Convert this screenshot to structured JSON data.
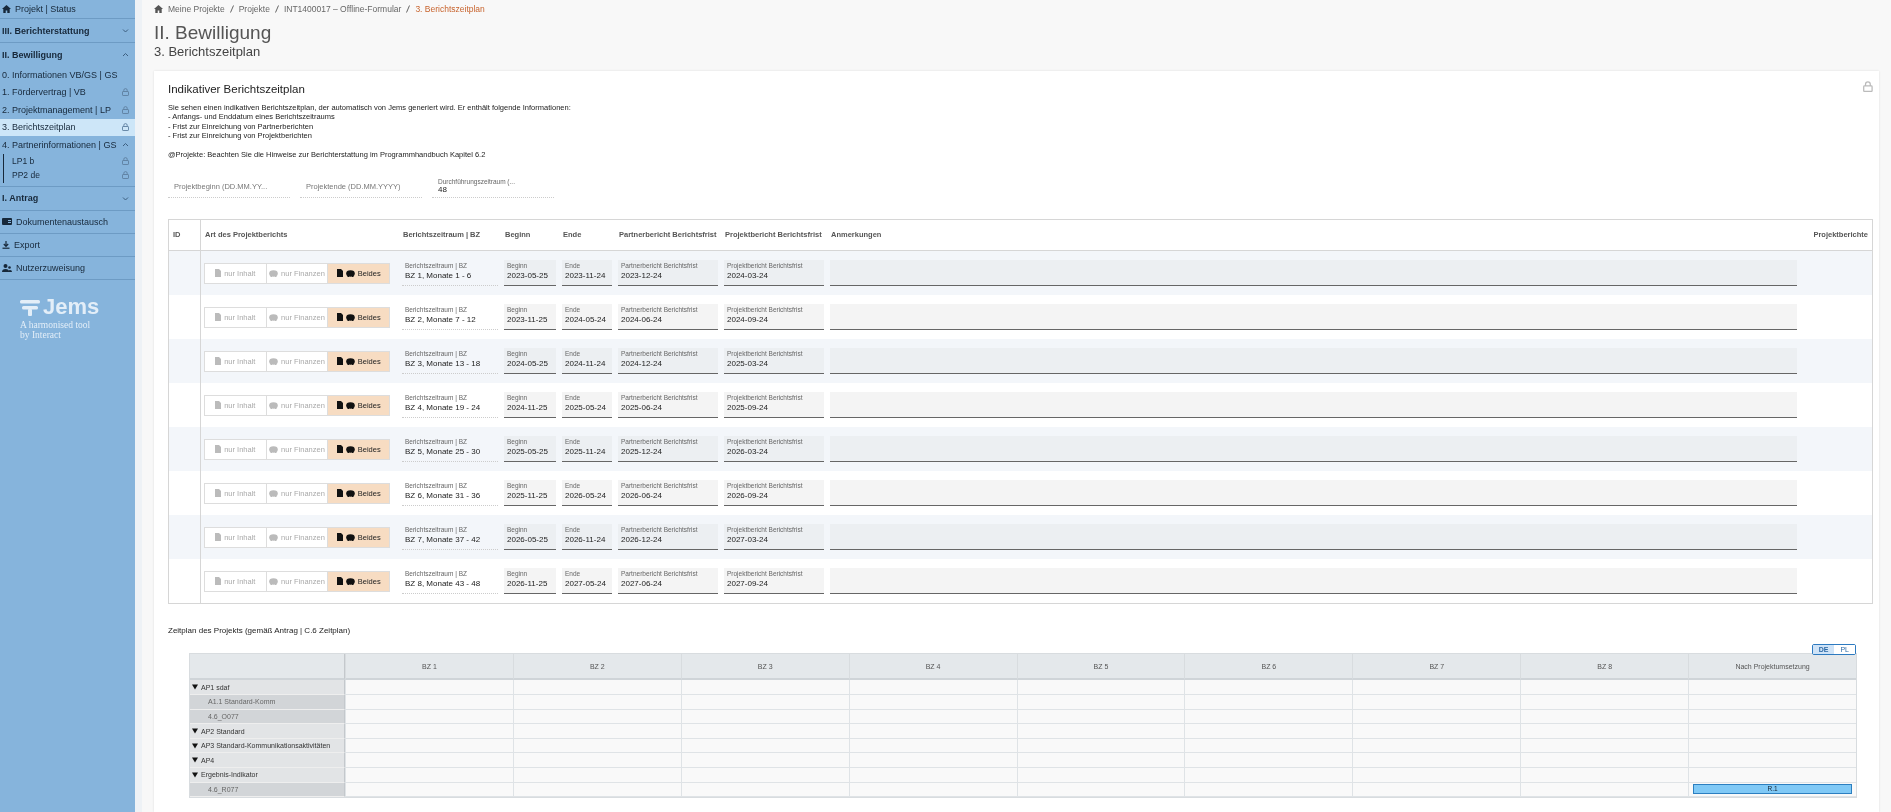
{
  "sidebar": {
    "items": [
      {
        "kind": "link",
        "label": "Projekt | Status",
        "selected": false
      },
      {
        "kind": "section",
        "label": "III. Berichterstattung",
        "expanded": false,
        "selected": false
      },
      {
        "kind": "section",
        "label": "II. Bewilligung",
        "expanded": true,
        "selected": false,
        "children": [
          {
            "label": "0. Informationen VB/GS | GS",
            "locked": false,
            "selected": false
          },
          {
            "label": "1. Fördervertrag | VB",
            "locked": true,
            "selected": false
          },
          {
            "label": "2. Projektmanagement | LP",
            "locked": true,
            "selected": false
          },
          {
            "label": "3. Berichtszeitplan",
            "locked": true,
            "selected": true
          },
          {
            "label": "4. Partnerinformationen | GS",
            "locked": false,
            "selected": false,
            "expanded": true,
            "children": [
              {
                "label": "LP1 b",
                "locked": true,
                "selected": false
              },
              {
                "label": "PP2 de",
                "locked": true,
                "selected": false
              }
            ]
          }
        ]
      },
      {
        "kind": "section",
        "label": "I. Antrag",
        "expanded": false,
        "selected": false
      },
      {
        "kind": "link",
        "label": "Dokumentenaustausch",
        "selected": false
      },
      {
        "kind": "link",
        "label": "Export",
        "selected": false
      },
      {
        "kind": "link",
        "label": "Nutzerzuweisung",
        "selected": false
      }
    ],
    "logo": {
      "name": "Jems",
      "tagline": "A harmonised tool",
      "by": "by Interact"
    }
  },
  "breadcrumb": [
    {
      "label": "Meine Projekte",
      "selected": false
    },
    {
      "label": "Projekte",
      "selected": false
    },
    {
      "label": "INT1400017 – Offline-Formular",
      "selected": false
    },
    {
      "label": "3. Berichtszeitplan",
      "selected": true
    }
  ],
  "page": {
    "title": "II. Bewilligung",
    "subtitle": "3. Berichtszeitplan"
  },
  "card": {
    "title": "Indikativer Berichtszeitplan",
    "locked": true,
    "intro": "Sie sehen einen indikativen Berichtszeitplan, der automatisch von Jems generiert wird. Er enthält folgende Informationen:",
    "bullets": [
      "- Anfangs- und Enddatum eines Berichtszeitraums",
      "- Frist zur Einreichung von Partnerberichten",
      "- Frist zur Einreichung von Projektberichten"
    ],
    "note": "@Projekte: Beachten Sie die Hinweise zur Berichterstattung im Programmhandbuch Kapitel 6.2",
    "fields": [
      {
        "placeholder": "Projektbeginn (DD.MM.YY..."
      },
      {
        "placeholder": "Projektende (DD.MM.YYYY)"
      },
      {
        "label": "Durchführungszeitraum (...",
        "value": "48"
      }
    ],
    "table": {
      "columns": [
        "ID",
        "Art des Projektberichts",
        "Berichtszeitraum | BZ",
        "Beginn",
        "Ende",
        "Partnerbericht Berichtsfrist",
        "Projektbericht Berichtsfrist",
        "Anmerkungen",
        "Projektberichte"
      ],
      "rows": [
        {
          "type_options": [
            {
              "label": "nur Inhalt",
              "selected": false
            },
            {
              "label": "nur Finanzen",
              "selected": false
            },
            {
              "label": "Beides",
              "selected": true
            }
          ],
          "fields": [
            {
              "label": "Berichtszeitraum | BZ",
              "value": "BZ 1, Monate 1 - 6"
            },
            {
              "label": "Beginn",
              "value": "2023-05-25"
            },
            {
              "label": "Ende",
              "value": "2023-11-24"
            },
            {
              "label": "Partnerbericht Berichtsfrist",
              "value": "2023-12-24"
            },
            {
              "label": "Projektbericht Berichtsfrist",
              "value": "2024-03-24"
            }
          ]
        },
        {
          "type_options": [
            {
              "label": "nur Inhalt",
              "selected": false
            },
            {
              "label": "nur Finanzen",
              "selected": false
            },
            {
              "label": "Beides",
              "selected": true
            }
          ],
          "fields": [
            {
              "label": "Berichtszeitraum | BZ",
              "value": "BZ 2, Monate 7 - 12"
            },
            {
              "label": "Beginn",
              "value": "2023-11-25"
            },
            {
              "label": "Ende",
              "value": "2024-05-24"
            },
            {
              "label": "Partnerbericht Berichtsfrist",
              "value": "2024-06-24"
            },
            {
              "label": "Projektbericht Berichtsfrist",
              "value": "2024-09-24"
            }
          ]
        },
        {
          "type_options": [
            {
              "label": "nur Inhalt",
              "selected": false
            },
            {
              "label": "nur Finanzen",
              "selected": false
            },
            {
              "label": "Beides",
              "selected": true
            }
          ],
          "fields": [
            {
              "label": "Berichtszeitraum | BZ",
              "value": "BZ 3, Monate 13 - 18"
            },
            {
              "label": "Beginn",
              "value": "2024-05-25"
            },
            {
              "label": "Ende",
              "value": "2024-11-24"
            },
            {
              "label": "Partnerbericht Berichtsfrist",
              "value": "2024-12-24"
            },
            {
              "label": "Projektbericht Berichtsfrist",
              "value": "2025-03-24"
            }
          ]
        },
        {
          "type_options": [
            {
              "label": "nur Inhalt",
              "selected": false
            },
            {
              "label": "nur Finanzen",
              "selected": false
            },
            {
              "label": "Beides",
              "selected": true
            }
          ],
          "fields": [
            {
              "label": "Berichtszeitraum | BZ",
              "value": "BZ 4, Monate 19 - 24"
            },
            {
              "label": "Beginn",
              "value": "2024-11-25"
            },
            {
              "label": "Ende",
              "value": "2025-05-24"
            },
            {
              "label": "Partnerbericht Berichtsfrist",
              "value": "2025-06-24"
            },
            {
              "label": "Projektbericht Berichtsfrist",
              "value": "2025-09-24"
            }
          ]
        },
        {
          "type_options": [
            {
              "label": "nur Inhalt",
              "selected": false
            },
            {
              "label": "nur Finanzen",
              "selected": false
            },
            {
              "label": "Beides",
              "selected": true
            }
          ],
          "fields": [
            {
              "label": "Berichtszeitraum | BZ",
              "value": "BZ 5, Monate 25 - 30"
            },
            {
              "label": "Beginn",
              "value": "2025-05-25"
            },
            {
              "label": "Ende",
              "value": "2025-11-24"
            },
            {
              "label": "Partnerbericht Berichtsfrist",
              "value": "2025-12-24"
            },
            {
              "label": "Projektbericht Berichtsfrist",
              "value": "2026-03-24"
            }
          ]
        },
        {
          "type_options": [
            {
              "label": "nur Inhalt",
              "selected": false
            },
            {
              "label": "nur Finanzen",
              "selected": false
            },
            {
              "label": "Beides",
              "selected": true
            }
          ],
          "fields": [
            {
              "label": "Berichtszeitraum | BZ",
              "value": "BZ 6, Monate 31 - 36"
            },
            {
              "label": "Beginn",
              "value": "2025-11-25"
            },
            {
              "label": "Ende",
              "value": "2026-05-24"
            },
            {
              "label": "Partnerbericht Berichtsfrist",
              "value": "2026-06-24"
            },
            {
              "label": "Projektbericht Berichtsfrist",
              "value": "2026-09-24"
            }
          ]
        },
        {
          "type_options": [
            {
              "label": "nur Inhalt",
              "selected": false
            },
            {
              "label": "nur Finanzen",
              "selected": false
            },
            {
              "label": "Beides",
              "selected": true
            }
          ],
          "fields": [
            {
              "label": "Berichtszeitraum | BZ",
              "value": "BZ 7, Monate 37 - 42"
            },
            {
              "label": "Beginn",
              "value": "2026-05-25"
            },
            {
              "label": "Ende",
              "value": "2026-11-24"
            },
            {
              "label": "Partnerbericht Berichtsfrist",
              "value": "2026-12-24"
            },
            {
              "label": "Projektbericht Berichtsfrist",
              "value": "2027-03-24"
            }
          ]
        },
        {
          "type_options": [
            {
              "label": "nur Inhalt",
              "selected": false
            },
            {
              "label": "nur Finanzen",
              "selected": false
            },
            {
              "label": "Beides",
              "selected": true
            }
          ],
          "fields": [
            {
              "label": "Berichtszeitraum | BZ",
              "value": "BZ 8, Monate 43 - 48"
            },
            {
              "label": "Beginn",
              "value": "2026-11-25"
            },
            {
              "label": "Ende",
              "value": "2027-05-24"
            },
            {
              "label": "Partnerbericht Berichtsfrist",
              "value": "2027-06-24"
            },
            {
              "label": "Projektbericht Berichtsfrist",
              "value": "2027-09-24"
            }
          ]
        }
      ]
    }
  },
  "timeline": {
    "title": "Zeitplan des Projekts (gemäß Antrag | C.6 Zeitplan)",
    "languages": [
      {
        "label": "DE",
        "selected": true
      },
      {
        "label": "PL",
        "selected": false
      }
    ],
    "columns": [
      "BZ 1",
      "BZ 2",
      "BZ 3",
      "BZ 4",
      "BZ 5",
      "BZ 6",
      "BZ 7",
      "BZ 8",
      "Nach Projektumsetzung"
    ],
    "rows": [
      {
        "label": "AP1 sdaf",
        "expanded": true,
        "children": [
          {
            "label": "A1.1 Standard-Komm"
          },
          {
            "label": "4.6_O077"
          }
        ]
      },
      {
        "label": "AP2 Standard",
        "expanded": true
      },
      {
        "label": "AP3 Standard-Kommunikationsaktivitäten",
        "expanded": true
      },
      {
        "label": "AP4",
        "expanded": true
      },
      {
        "label": "Ergebnis-Indikator",
        "expanded": true,
        "children": [
          {
            "label": "4.6_R077",
            "bar": {
              "label": "R.1"
            }
          }
        ]
      }
    ]
  }
}
